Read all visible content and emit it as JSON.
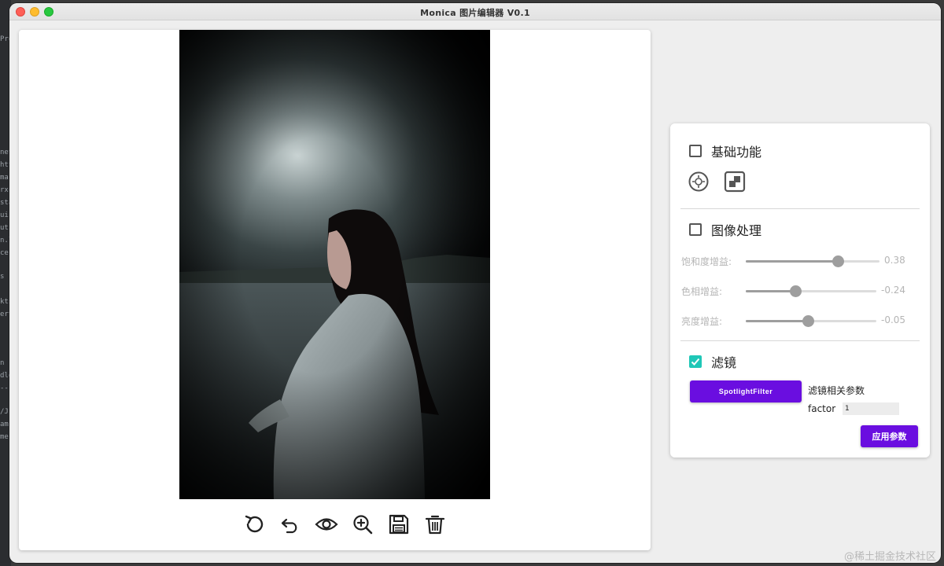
{
  "window": {
    "title": "Monica 图片编辑器 V0.1"
  },
  "background_ide": {
    "fragments": [
      "Pro",
      "net",
      "htt",
      "ma",
      "rxc",
      "sta",
      "ui",
      "uti",
      "n.l",
      "ce",
      "s",
      "kts",
      "erti",
      "n",
      "dle",
      "--",
      "/J",
      "am",
      "me"
    ]
  },
  "toolbar": {
    "buttons": [
      {
        "name": "rotate-icon"
      },
      {
        "name": "undo-icon"
      },
      {
        "name": "eye-icon"
      },
      {
        "name": "zoom-in-icon"
      },
      {
        "name": "save-icon"
      },
      {
        "name": "trash-icon"
      }
    ]
  },
  "panel": {
    "basic": {
      "label": "基础功能",
      "checked": false,
      "icons": [
        "color-picker-icon",
        "crop-icon"
      ]
    },
    "image_processing": {
      "label": "图像处理",
      "checked": false,
      "sliders": [
        {
          "label": "饱和度增益:",
          "value": "0.38",
          "fraction": 0.69
        },
        {
          "label": "色相增益:",
          "value": "-0.24",
          "fraction": 0.38
        },
        {
          "label": "亮度增益:",
          "value": "-0.05",
          "fraction": 0.475
        }
      ]
    },
    "filter": {
      "label": "滤镜",
      "checked": true,
      "button_label": "SpotlightFilter",
      "params_title": "滤镜相关参数",
      "param_label": "factor",
      "param_value": "1",
      "apply_label": "应用参数"
    }
  },
  "watermark": "@稀土掘金技术社区",
  "colors": {
    "accent": "#6a0ee0",
    "checkbox_checked": "#1fc7b7"
  }
}
